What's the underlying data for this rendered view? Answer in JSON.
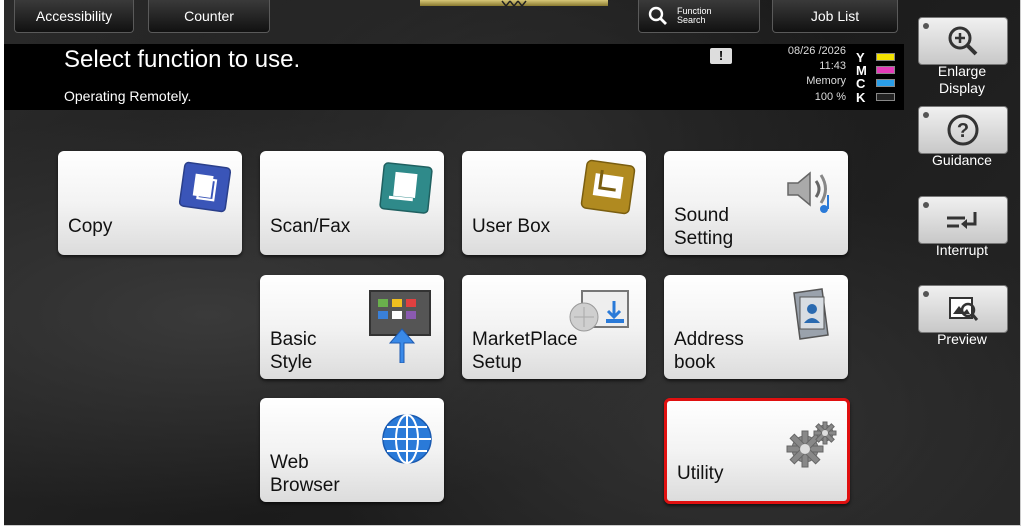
{
  "top": {
    "accessibility": "Accessibility",
    "counter": "Counter",
    "function_search_line1": "Function",
    "function_search_line2": "Search",
    "job_list": "Job List"
  },
  "status": {
    "title": "Select function to use.",
    "subtitle": "Operating Remotely.",
    "date": "08/26 /2026",
    "time": "11:43",
    "memory_label": "Memory",
    "memory_value": "100 %",
    "toner": [
      {
        "letter": "Y",
        "color": "#f2e200"
      },
      {
        "letter": "M",
        "color": "#e43bb8"
      },
      {
        "letter": "C",
        "color": "#2a9ee8"
      },
      {
        "letter": "K",
        "color": "#222222"
      }
    ]
  },
  "tiles": {
    "copy": "Copy",
    "scan_fax": "Scan/Fax",
    "user_box": "User Box",
    "sound_1": "Sound",
    "sound_2": "Setting",
    "basic_1": "Basic",
    "basic_2": "Style",
    "market_1": "MarketPlace",
    "market_2": "Setup",
    "address_1": "Address",
    "address_2": "book",
    "web_1": "Web",
    "web_2": "Browser",
    "utility": "Utility"
  },
  "side": {
    "enlarge_1": "Enlarge",
    "enlarge_2": "Display",
    "guidance": "Guidance",
    "interrupt": "Interrupt",
    "preview": "Preview"
  },
  "colors": {
    "selection": "#e01010",
    "copy_icon": "#3a55b8",
    "scan_icon": "#2f8a8a",
    "userbox_icon": "#b08a20",
    "web_icon": "#2a7ad8"
  }
}
